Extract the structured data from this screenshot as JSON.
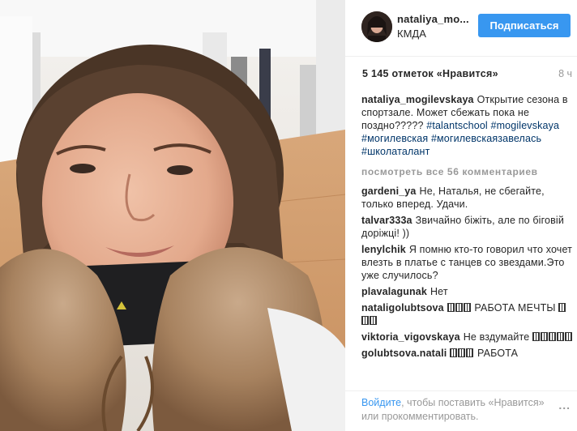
{
  "header": {
    "username": "nataliya_mo...",
    "location": "КМДА",
    "follow_label": "Подписаться"
  },
  "post": {
    "likes": "5 145 отметок «Нравится»",
    "time": "8 ч"
  },
  "caption": {
    "user": "nataliya_mogilevskaya",
    "text": "Открытие сезона в спортзале. Может сбежать пока не поздно?????",
    "tags": [
      "#talantschool",
      "#mogilevskaya",
      "#могилевская",
      "#могилевскаязавелась",
      "#школаталант"
    ]
  },
  "view_all": "посмотреть все 56 комментариев",
  "comments": [
    {
      "user": "gardeni_ya",
      "text": "Не, Наталья, не сбегайте, только вперед. Удачи."
    },
    {
      "user": "talvar333a",
      "text": "Звичайно біжіть, але по біговій доріжці! ))"
    },
    {
      "user": "lenylchik",
      "text": "Я помню кто-то говорил что хочет влезть в платье с танцев со звездами.Это уже случилось?"
    },
    {
      "user": "plavalagunak",
      "text": "Нет"
    },
    {
      "user": "nataligolubtsova",
      "text_after": "РАБОТА МЕЧТЫ"
    },
    {
      "user": "viktoria_vigovskaya",
      "text": "Не вздумайте"
    },
    {
      "user": "golubtsova.natali",
      "text_after": "РАБОТА"
    }
  ],
  "footer": {
    "login": "Войдите",
    "text": ", чтобы поставить «Нравится» или прокомментировать.",
    "more": "..."
  },
  "icons": {
    "options": "more-icon"
  },
  "colors": {
    "accent": "#3897f0",
    "hashtag": "#003569",
    "muted": "#999999"
  }
}
